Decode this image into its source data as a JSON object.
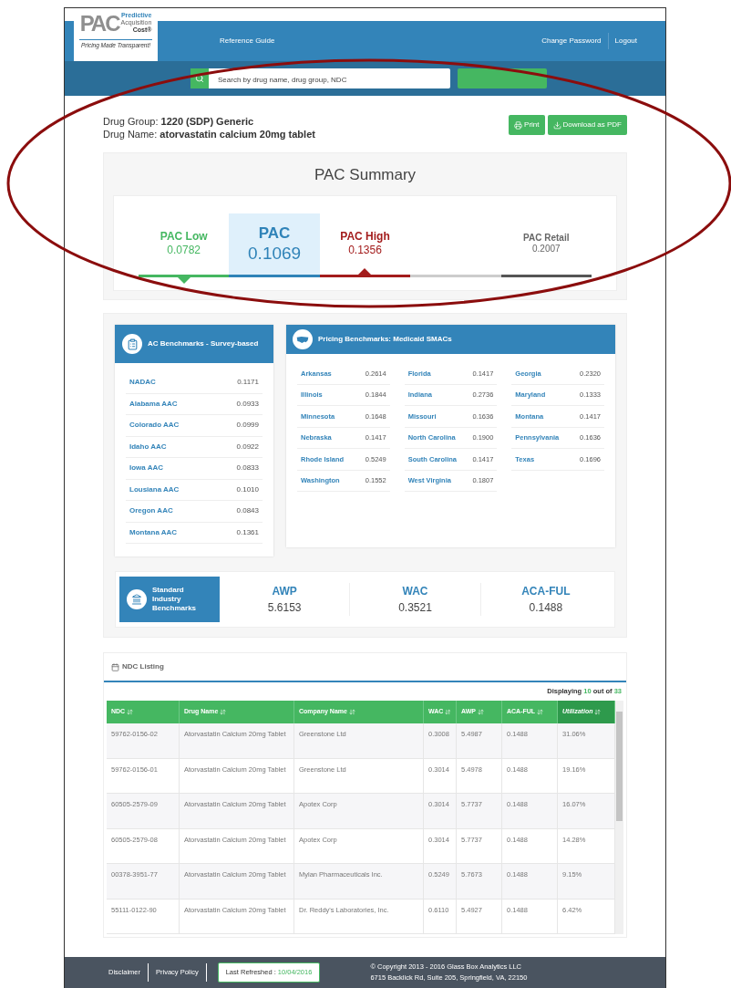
{
  "header": {
    "logo": {
      "mark": "PAC",
      "line1": "Predictive",
      "line2": "Acquisition",
      "line2_bold": "Cost®",
      "tagline": "Pricing Made Transparent!"
    },
    "nav_left": [
      "Reference Guide"
    ],
    "nav_right": [
      "Change Password",
      "Logout"
    ]
  },
  "search": {
    "placeholder": "Search by drug name, drug group, NDC"
  },
  "drug": {
    "group_label": "Drug Group:",
    "group": "1220 (SDP) Generic",
    "name_label": "Drug Name:",
    "name": "atorvastatin calcium 20mg tablet"
  },
  "actions": [
    {
      "kind": "print",
      "label": "Print"
    },
    {
      "kind": "download",
      "label": "Download as PDF"
    }
  ],
  "pac_summary": {
    "title": "PAC Summary",
    "items": [
      {
        "kind": "low",
        "label": "PAC Low",
        "value": "0.0782",
        "color": "#45b761",
        "selected": false
      },
      {
        "kind": "pac",
        "label": "PAC",
        "value": "0.1069",
        "color": "#2f83b8",
        "selected": true
      },
      {
        "kind": "high",
        "label": "PAC High",
        "value": "0.1356",
        "color": "#a31c1c",
        "selected": false
      },
      {
        "kind": "retail",
        "label": "PAC Retail",
        "value": "0.2007",
        "color": "#666666",
        "selected": false
      }
    ],
    "scale": [
      {
        "color": "#45b761",
        "marker_below": true,
        "marker_above": false
      },
      {
        "color": "#2f83b8",
        "marker_below": false,
        "marker_above": false
      },
      {
        "color": "#a31c1c",
        "marker_below": false,
        "marker_above": true
      },
      {
        "color": "#cccccc",
        "marker_below": false,
        "marker_above": false
      },
      {
        "color": "#555555",
        "marker_below": false,
        "marker_above": false
      }
    ]
  },
  "ac_benchmarks": {
    "title": "AC Benchmarks - Survey-based",
    "rows": [
      {
        "name": "NADAC",
        "value": "0.1171"
      },
      {
        "name": "Alabama AAC",
        "value": "0.0933"
      },
      {
        "name": "Colorado AAC",
        "value": "0.0999"
      },
      {
        "name": "Idaho AAC",
        "value": "0.0922"
      },
      {
        "name": "Iowa AAC",
        "value": "0.0833"
      },
      {
        "name": "Lousiana AAC",
        "value": "0.1010"
      },
      {
        "name": "Oregon AAC",
        "value": "0.0843"
      },
      {
        "name": "Montana AAC",
        "value": "0.1361"
      }
    ]
  },
  "smac": {
    "title": "Pricing Benchmarks: Medicaid SMACs",
    "columns": [
      [
        {
          "name": "Arkansas",
          "value": "0.2614"
        },
        {
          "name": "Illinois",
          "value": "0.1844"
        },
        {
          "name": "Minnesota",
          "value": "0.1648"
        },
        {
          "name": "Nebraska",
          "value": "0.1417"
        },
        {
          "name": "Rhode Island",
          "value": "0.5249"
        },
        {
          "name": "Washington",
          "value": "0.1552"
        }
      ],
      [
        {
          "name": "Florida",
          "value": "0.1417"
        },
        {
          "name": "Indiana",
          "value": "0.2736"
        },
        {
          "name": "Missouri",
          "value": "0.1636"
        },
        {
          "name": "North Carolina",
          "value": "0.1900"
        },
        {
          "name": "South Carolina",
          "value": "0.1417"
        },
        {
          "name": "West Virginia",
          "value": "0.1807"
        }
      ],
      [
        {
          "name": "Georgia",
          "value": "0.2320"
        },
        {
          "name": "Maryland",
          "value": "0.1333"
        },
        {
          "name": "Montana",
          "value": "0.1417"
        },
        {
          "name": "Pennsylvania",
          "value": "0.1636"
        },
        {
          "name": "Texas",
          "value": "0.1696"
        }
      ]
    ]
  },
  "standard": {
    "title": "Standard Industry Benchmarks",
    "items": [
      {
        "label": "AWP",
        "value": "5.6153"
      },
      {
        "label": "WAC",
        "value": "0.3521"
      },
      {
        "label": "ACA-FUL",
        "value": "0.1488"
      }
    ]
  },
  "ndc": {
    "title": "NDC Listing",
    "displaying": "Displaying",
    "shown": "10",
    "out_of": "out of",
    "total": "33",
    "columns": [
      {
        "label": "NDC",
        "selected": false
      },
      {
        "label": "Drug Name",
        "selected": false
      },
      {
        "label": "Company Name",
        "selected": false
      },
      {
        "label": "WAC",
        "selected": false
      },
      {
        "label": "AWP",
        "selected": false
      },
      {
        "label": "ACA-FUL",
        "selected": false
      },
      {
        "label": "Utilization",
        "selected": true
      }
    ],
    "rows": [
      [
        "59762-0156-02",
        "Atorvastatin Calcium 20mg Tablet",
        "Greenstone Ltd",
        "0.3008",
        "5.4987",
        "0.1488",
        "31.06%"
      ],
      [
        "59762-0156-01",
        "Atorvastatin Calcium 20mg Tablet",
        "Greenstone Ltd",
        "0.3014",
        "5.4978",
        "0.1488",
        "19.16%"
      ],
      [
        "60505-2579-09",
        "Atorvastatin Calcium 20mg Tablet",
        "Apotex Corp",
        "0.3014",
        "5.7737",
        "0.1488",
        "16.07%"
      ],
      [
        "60505-2579-08",
        "Atorvastatin Calcium 20mg Tablet",
        "Apotex Corp",
        "0.3014",
        "5.7737",
        "0.1488",
        "14.28%"
      ],
      [
        "00378-3951-77",
        "Atorvastatin Calcium 20mg Tablet",
        "Mylan Pharmaceuticals Inc.",
        "0.5249",
        "5.7673",
        "0.1488",
        "9.15%"
      ],
      [
        "55111-0122-90",
        "Atorvastatin Calcium 20mg Tablet",
        "Dr. Reddy's Laboratories, Inc.",
        "0.6110",
        "5.4927",
        "0.1488",
        "6.42%"
      ]
    ]
  },
  "footer": {
    "links": [
      "Disclaimer",
      "Privacy Policy"
    ],
    "refreshed_label": "Last Refreshed :",
    "refreshed_date": "10/04/2016",
    "copyright": [
      "© Copyright 2013 - 2016 Glass Box Analytics LLC",
      "6715 Backlick Rd, Suite 205, Springfield, VA, 22150"
    ]
  }
}
